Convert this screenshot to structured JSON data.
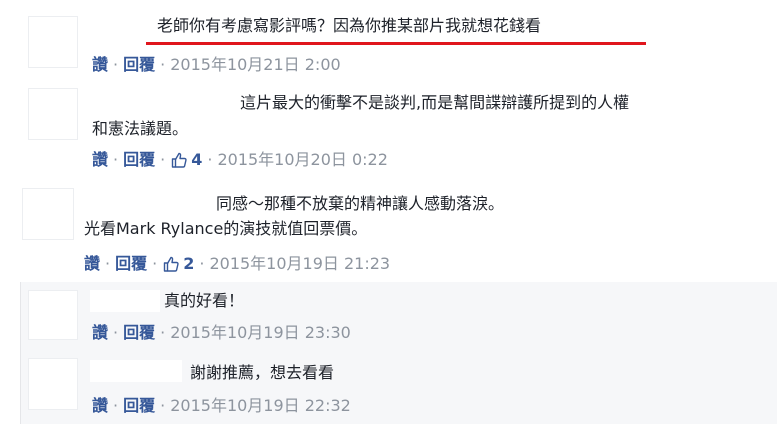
{
  "comments": [
    {
      "text": "老師你有考慮寫影評嗎？因為你推某部片我就想花錢看",
      "actions": {
        "like": "讚",
        "reply": "回覆"
      },
      "likes": null,
      "timestamp": "2015年10月21日 2:00",
      "highlight_color": "#e0161d"
    },
    {
      "text_line1": "這片最大的衝擊不是談判,而是幫間諜辯護所提到的人權",
      "text_line2": "和憲法議題。",
      "actions": {
        "like": "讚",
        "reply": "回覆"
      },
      "likes": "4",
      "timestamp": "2015年10月20日 0:22"
    },
    {
      "text_line1": "同感～那種不放棄的精神讓人感動落淚。",
      "text_line2": "光看Mark Rylance的演技就值回票價。",
      "actions": {
        "like": "讚",
        "reply": "回覆"
      },
      "likes": "2",
      "timestamp": "2015年10月19日 21:23"
    },
    {
      "text": "真的好看！",
      "actions": {
        "like": "讚",
        "reply": "回覆"
      },
      "likes": null,
      "timestamp": "2015年10月19日 23:30"
    },
    {
      "text": "謝謝推薦，想去看看",
      "actions": {
        "like": "讚",
        "reply": "回覆"
      },
      "likes": null,
      "timestamp": "2015年10月19日 22:32"
    }
  ],
  "icons": {
    "like": "thumbs-up-outline-icon"
  },
  "colors": {
    "link": "#365899",
    "meta": "#8d949e",
    "underline": "#e0161d"
  }
}
